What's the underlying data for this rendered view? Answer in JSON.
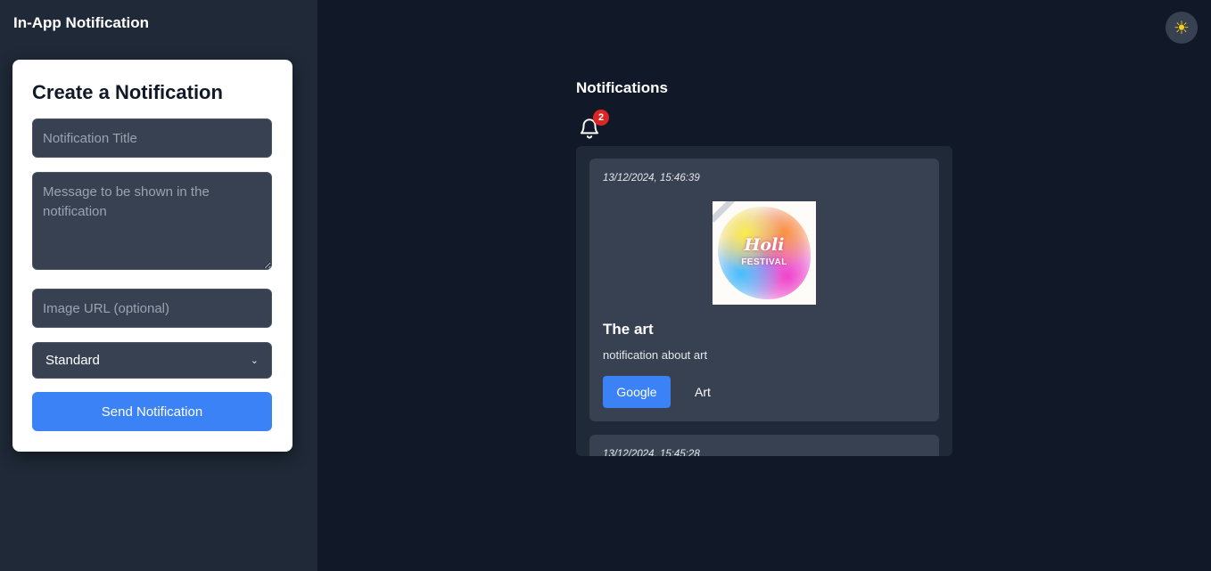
{
  "app": {
    "title": "In-App Notification"
  },
  "form": {
    "heading": "Create a Notification",
    "title_placeholder": "Notification Title",
    "message_placeholder": "Message to be shown in the notification",
    "image_placeholder": "Image URL (optional)",
    "type_selected": "Standard",
    "send_label": "Send Notification"
  },
  "theme": {
    "icon": "sun-icon",
    "glyph": "☀"
  },
  "notifications": {
    "heading": "Notifications",
    "badge_count": "2",
    "items": [
      {
        "timestamp": "13/12/2024, 15:46:39",
        "image_text_main": "Holi",
        "image_text_sub": "FESTIVAL",
        "title": "The art",
        "message": "notification about art",
        "primary_action": "Google",
        "secondary_action": "Art"
      },
      {
        "timestamp": "13/12/2024, 15:45:28"
      }
    ]
  },
  "colors": {
    "background": "#111827",
    "sidebar": "#1f2937",
    "card": "#374151",
    "accent": "#3b82f6",
    "badge": "#dc2626"
  }
}
